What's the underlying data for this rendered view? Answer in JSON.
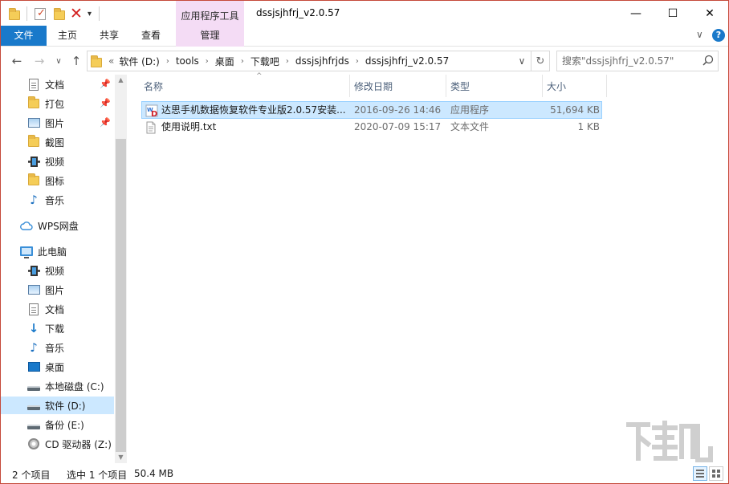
{
  "title_bar": {
    "window_title": "dssjsjhfrj_v2.0.57",
    "tool_tab": "应用程序工具",
    "minimize": "—",
    "maximize": "☐",
    "close": "✕",
    "quick_access_dropdown": "▾"
  },
  "ribbon": {
    "tabs": [
      "文件",
      "主页",
      "共享",
      "查看",
      "管理"
    ],
    "expand": "∨",
    "help": "?"
  },
  "address_bar": {
    "back": "←",
    "forward": "→",
    "recent": "∨",
    "up": "↑",
    "overflow": "«",
    "crumbs": [
      "软件 (D:)",
      "tools",
      "桌面",
      "下载吧",
      "dssjsjhfrjds",
      "dssjsjhfrj_v2.0.57"
    ],
    "separator": "›",
    "dropdown": "∨",
    "refresh": "↻"
  },
  "search": {
    "placeholder": "搜索\"dssjsjhfrj_v2.0.57\""
  },
  "nav_pane": {
    "quick_access": [
      {
        "label": "文档",
        "icon": "document-icon",
        "pinned": true
      },
      {
        "label": "打包",
        "icon": "folder-icon",
        "pinned": true
      },
      {
        "label": "图片",
        "icon": "pictures-icon",
        "pinned": true
      },
      {
        "label": "截图",
        "icon": "folder-icon",
        "pinned": false
      },
      {
        "label": "视频",
        "icon": "video-icon",
        "pinned": false
      },
      {
        "label": "图标",
        "icon": "folder-icon",
        "pinned": false
      },
      {
        "label": "音乐",
        "icon": "music-icon",
        "pinned": false
      }
    ],
    "wps": "WPS网盘",
    "this_pc": "此电脑",
    "pc_items": [
      {
        "label": "视频",
        "icon": "video-icon"
      },
      {
        "label": "图片",
        "icon": "pictures-icon"
      },
      {
        "label": "文档",
        "icon": "document-icon"
      },
      {
        "label": "下载",
        "icon": "download-icon"
      },
      {
        "label": "音乐",
        "icon": "music-icon"
      },
      {
        "label": "桌面",
        "icon": "desktop-icon"
      },
      {
        "label": "本地磁盘 (C:)",
        "icon": "drive-icon"
      },
      {
        "label": "软件 (D:)",
        "icon": "drive-icon"
      },
      {
        "label": "备份 (E:)",
        "icon": "drive-icon"
      },
      {
        "label": "CD 驱动器 (Z:)",
        "icon": "cd-drive-icon"
      }
    ],
    "selected": "软件 (D:)",
    "pin_glyph": "📌"
  },
  "columns": {
    "name": "名称",
    "modified": "修改日期",
    "type": "类型",
    "size": "大小",
    "sort_indicator": "^"
  },
  "files": [
    {
      "name": "达思手机数据恢复软件专业版2.0.57安装...",
      "modified": "2016-09-26 14:46",
      "type": "应用程序",
      "size": "51,694 KB",
      "icon": "installer-icon",
      "selected": true
    },
    {
      "name": "使用说明.txt",
      "modified": "2020-07-09 15:17",
      "type": "文本文件",
      "size": "1 KB",
      "icon": "text-file-icon",
      "selected": false
    }
  ],
  "status_bar": {
    "item_count": "2 个项目",
    "selection": "选中 1 个项目",
    "selection_size": "50.4 MB"
  },
  "colors": {
    "accent": "#1979ca",
    "tool_tab": "#f4dcf5",
    "selection": "#cce8ff",
    "window_border": "#c54a3a"
  }
}
